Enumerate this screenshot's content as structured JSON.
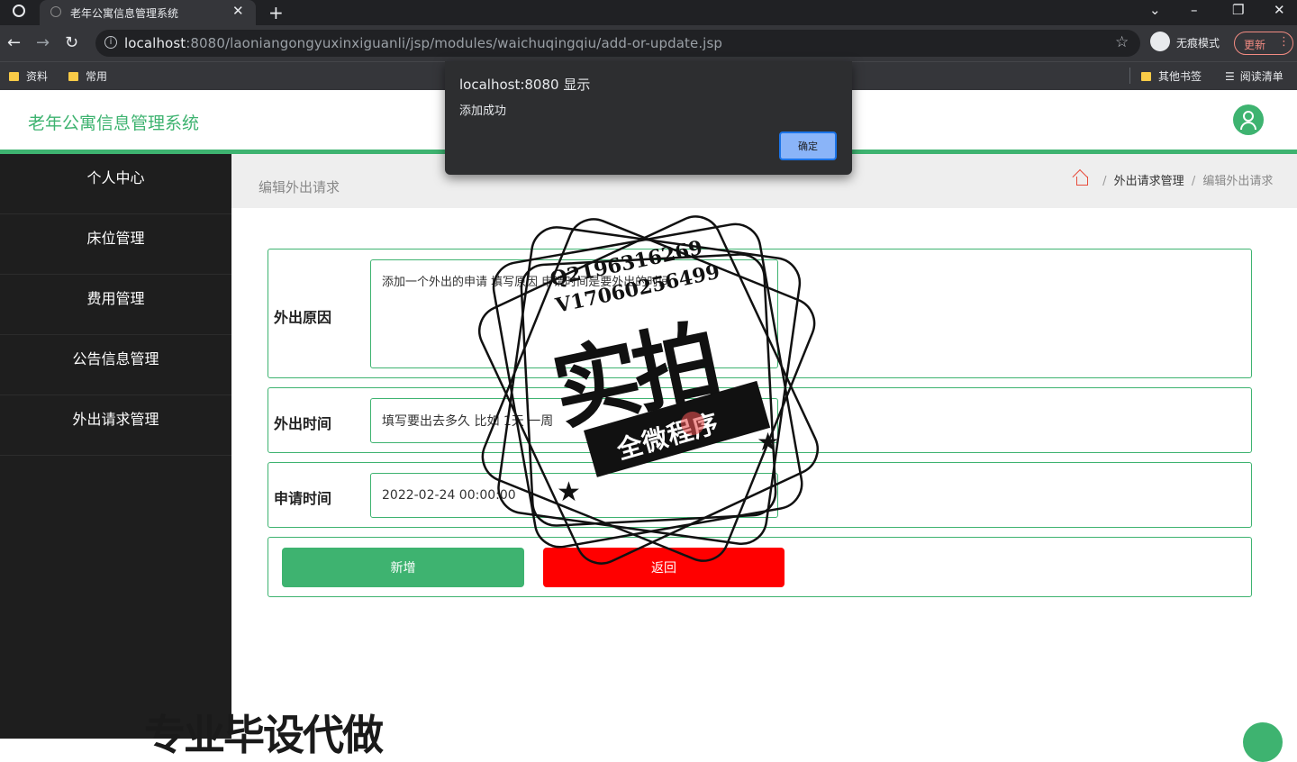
{
  "browser": {
    "tab_title": "老年公寓信息管理系统",
    "url_host": "localhost",
    "url_rest": ":8080/laoniangongyuxinxiguanli/jsp/modules/waichuqingqiu/add-or-update.jsp",
    "incognito_label": "无痕模式",
    "update_label": "更新",
    "bookmarks": [
      "资料",
      "常用"
    ],
    "bookmarks_right": [
      "其他书签",
      "阅读清单"
    ]
  },
  "alert": {
    "title": "localhost:8080 显示",
    "message": "添加成功",
    "ok_label": "确定"
  },
  "app": {
    "title": "老年公寓信息管理系统"
  },
  "sidebar": {
    "items": [
      "个人中心",
      "床位管理",
      "费用管理",
      "公告信息管理",
      "外出请求管理"
    ]
  },
  "page": {
    "heading": "编辑外出请求",
    "breadcrumb": {
      "parent": "外出请求管理",
      "current": "编辑外出请求"
    }
  },
  "form": {
    "reason_label": "外出原因",
    "reason_value": "添加一个外出的申请 填写原因 申请时间是要外出的时间",
    "time_label": "外出时间",
    "time_value": "填写要出去多久 比如 1天 一周",
    "apply_label": "申请时间",
    "apply_value": "2022-02-24 00:00:00",
    "submit_label": "新增",
    "back_label": "返回"
  },
  "watermark": {
    "contact_q": "Q2196316269",
    "contact_v": "V17060256499",
    "big_text": "实拍",
    "band_text": "全微程序",
    "bottom_text": "专业毕设代做"
  },
  "colors": {
    "accent": "#3eb370",
    "danger": "#ff0000",
    "sidebar": "#1e1e1e"
  }
}
